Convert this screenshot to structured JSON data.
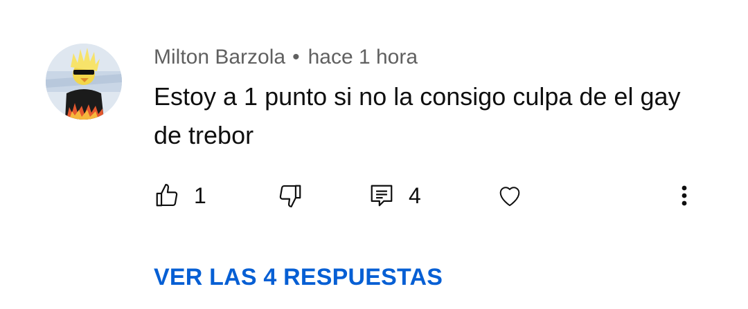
{
  "comment": {
    "author": "Milton Barzola",
    "separator": "•",
    "time": "hace 1 hora",
    "text": "Estoy a 1 punto si no la consigo culpa de el gay de trebor"
  },
  "actions": {
    "like_icon": "thumbs-up-icon",
    "like_count": "1",
    "dislike_icon": "thumbs-down-icon",
    "reply_icon": "comment-icon",
    "reply_count": "4",
    "heart_icon": "heart-icon",
    "more_icon": "more-vert-icon"
  },
  "replies": {
    "label": "VER LAS 4 RESPUESTAS"
  },
  "colors": {
    "link": "#065fd4",
    "meta": "#606060",
    "text": "#0f0f0f"
  }
}
